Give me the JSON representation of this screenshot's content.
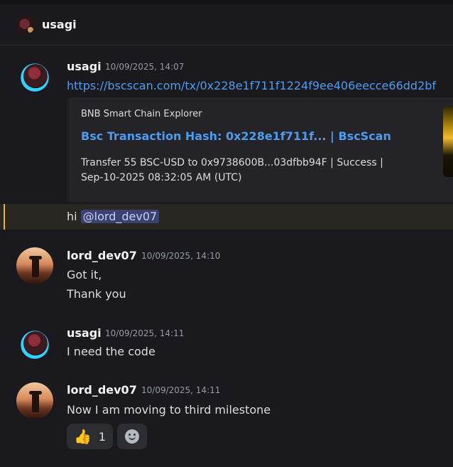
{
  "channel": {
    "title": "usagi"
  },
  "messages": [
    {
      "username": "usagi",
      "timestamp": "10/09/2025, 14:07",
      "link": "https://bscscan.com/tx/0x228e1f711f1224f9ee406eecce66dd2bf",
      "embed": {
        "provider": "BNB Smart Chain Explorer",
        "title": "Bsc Transaction Hash: 0x228e1f711f... | BscScan",
        "description_line1": "Transfer 55 BSC-USD to 0x9738600B...03dfbb94F | Success |",
        "description_line2": "Sep-10-2025 08:32:05 AM (UTC)"
      },
      "followup_prefix": "hi ",
      "followup_mention": "@lord_dev07"
    },
    {
      "username": "lord_dev07",
      "timestamp": "10/09/2025, 14:10",
      "line1": "Got it,",
      "line2": "Thank you"
    },
    {
      "username": "usagi",
      "timestamp": "10/09/2025, 14:11",
      "line1": "I need the code"
    },
    {
      "username": "lord_dev07",
      "timestamp": "10/09/2025, 14:11",
      "line1": "Now I am moving to third milestone",
      "reaction": {
        "emoji": "👍",
        "count": "1"
      }
    }
  ],
  "colors": {
    "link": "#4e9cf0",
    "mention_bg": "#3c4270",
    "highlight_bar": "#f0b232"
  }
}
